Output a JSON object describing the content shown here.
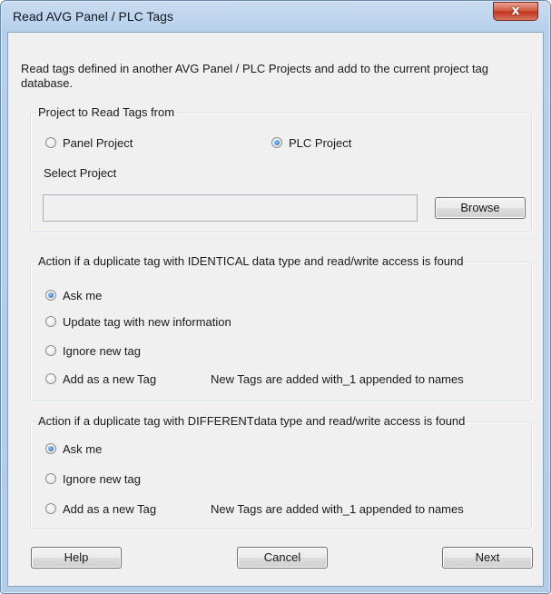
{
  "window": {
    "title": "Read AVG Panel / PLC Tags",
    "close_glyph": "x"
  },
  "description": "Read tags defined in another AVG Panel / PLC Projects and add to the current project tag database.",
  "project_group": {
    "legend": "Project to Read Tags from",
    "options": [
      "Panel Project",
      "PLC Project"
    ],
    "selected": "PLC Project",
    "select_label": "Select Project",
    "path_value": "",
    "browse_label": "Browse"
  },
  "identical_group": {
    "legend": "Action if a duplicate tag with IDENTICAL data type and read/write access is found",
    "options": [
      "Ask me",
      "Update tag with new information",
      "Ignore new tag",
      "Add as a new Tag"
    ],
    "selected": "Ask me",
    "note": "New Tags are added with_1 appended to names"
  },
  "different_group": {
    "legend": "Action if a duplicate tag with DIFFERENTdata type and read/write access is found",
    "options": [
      "Ask me",
      "Ignore new tag",
      "Add as a new Tag"
    ],
    "selected": "Ask me",
    "note": "New Tags are added with_1 appended to names"
  },
  "buttons": {
    "help": "Help",
    "cancel": "Cancel",
    "next": "Next"
  },
  "colors": {
    "title_bar": "#b9d1ea",
    "client": "#f0f0f0",
    "close": "#c7432b",
    "radio_selected": "#1c5fb8"
  }
}
